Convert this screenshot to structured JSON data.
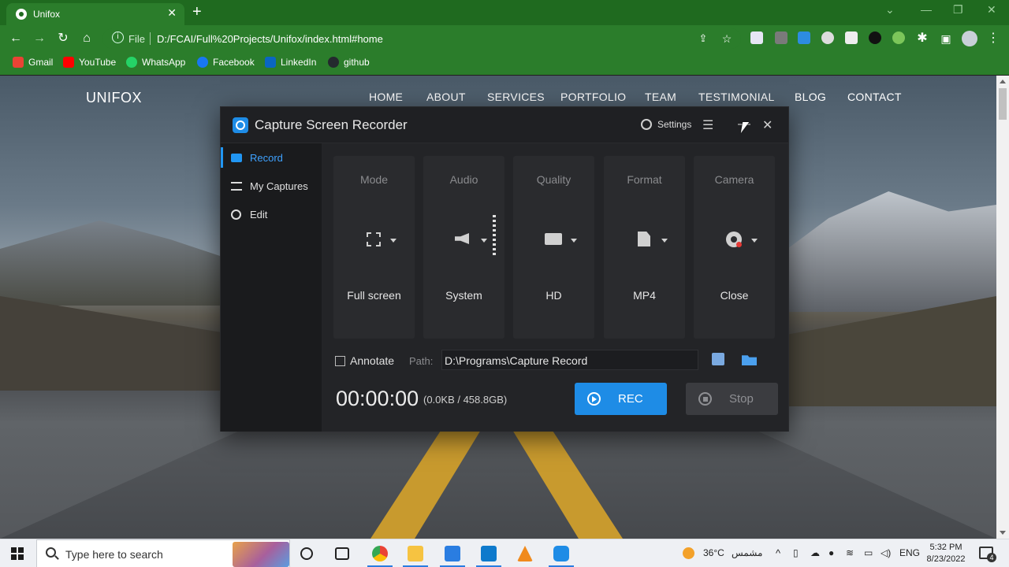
{
  "browser": {
    "tab_title": "Unifox",
    "address_scheme": "File",
    "address_url": "D:/FCAI/Full%20Projects/Unifox/index.html#home",
    "bookmarks": [
      {
        "label": "Gmail",
        "color": "#ea4335"
      },
      {
        "label": "YouTube",
        "color": "#ff0000"
      },
      {
        "label": "WhatsApp",
        "color": "#25d366"
      },
      {
        "label": "Facebook",
        "color": "#1877f2"
      },
      {
        "label": "LinkedIn",
        "color": "#0a66c2"
      },
      {
        "label": "github",
        "color": "#24292e"
      }
    ]
  },
  "site": {
    "logo": "UNIFOX",
    "nav": [
      "HOME",
      "ABOUT",
      "SERVICES",
      "PORTFOLIO",
      "TEAM",
      "TESTIMONIAL",
      "BLOG",
      "CONTACT"
    ]
  },
  "recorder": {
    "title": "Capture Screen Recorder",
    "settings_label": "Settings",
    "sidebar": [
      {
        "label": "Record",
        "icon": "video-camera-icon",
        "active": true
      },
      {
        "label": "My Captures",
        "icon": "list-icon",
        "active": false
      },
      {
        "label": "Edit",
        "icon": "edit-tools-icon",
        "active": false
      }
    ],
    "options": [
      {
        "header": "Mode",
        "value": "Full screen",
        "icon": "fullscreen-icon"
      },
      {
        "header": "Audio",
        "value": "System",
        "icon": "speaker-icon"
      },
      {
        "header": "Quality",
        "value": "HD",
        "icon": "monitor-icon"
      },
      {
        "header": "Format",
        "value": "MP4",
        "icon": "file-icon"
      },
      {
        "header": "Camera",
        "value": "Close",
        "icon": "webcam-icon"
      }
    ],
    "annotate_label": "Annotate",
    "annotate_checked": false,
    "path_label": "Path:",
    "path_value": "D:\\Programs\\Capture Record",
    "timer": "00:00:00",
    "size": "(0.0KB / 458.8GB)",
    "rec_label": "REC",
    "stop_label": "Stop",
    "accent": "#1e8ce6"
  },
  "taskbar": {
    "search_placeholder": "Type here to search",
    "temperature": "36°C",
    "weather_text": "مشمس",
    "language": "ENG",
    "time": "5:32 PM",
    "date": "8/23/2022",
    "notification_count": "4"
  }
}
